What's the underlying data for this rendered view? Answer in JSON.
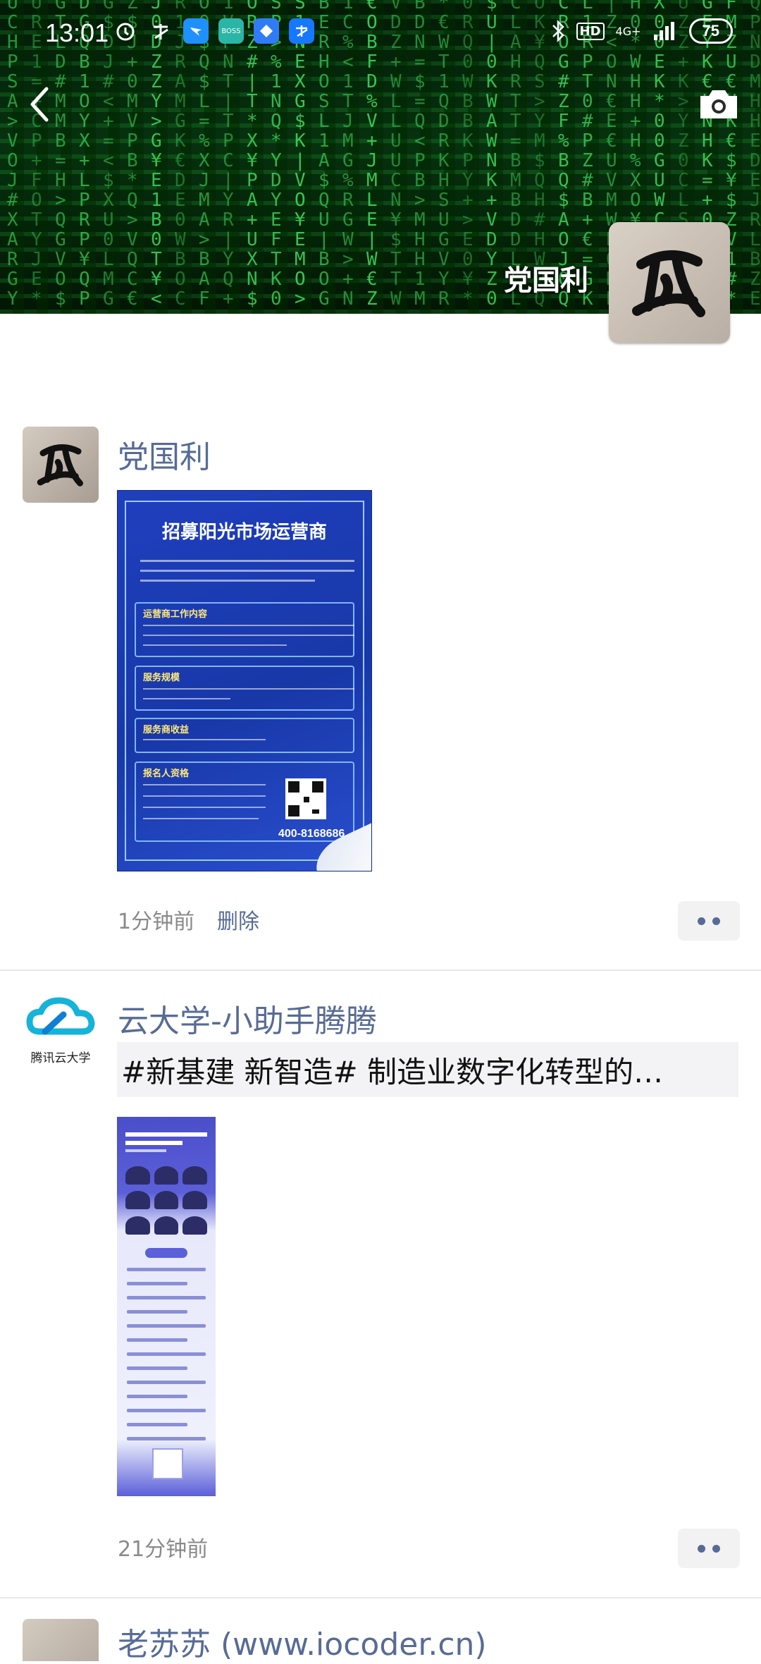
{
  "status_bar": {
    "time": "13:01",
    "right_labels": [
      "HD",
      "4G+"
    ],
    "battery": "75",
    "icons": [
      "alarm-icon",
      "alipay-icon",
      "dingtalk-icon",
      "boss-zhipin-icon",
      "app-icon",
      "alipay-icon",
      "bluetooth-icon",
      "signal-icon"
    ]
  },
  "header": {
    "cover_name": "党国利",
    "back_icon": "back-arrow-icon",
    "camera_icon": "camera-icon"
  },
  "posts": [
    {
      "author": "党国利",
      "image_poster": {
        "title": "招募阳光市场运营商",
        "section_1": "运营商工作内容",
        "section_2": "服务规模",
        "section_3": "服务商收益",
        "section_4": "报名人资格",
        "phone": "400-8168686"
      },
      "time": "1分钟前",
      "delete_label": "删除"
    },
    {
      "author": "云大学-小助手腾腾",
      "avatar_label": "腾讯云大学",
      "share_text": "#新基建 新智造# 制造业数字化转型的…",
      "time": "21分钟前"
    },
    {
      "author": "老苏苏 (www.iocoder.cn)"
    }
  ],
  "colors": {
    "name_link": "#576b95",
    "meta": "#8a8a8a",
    "matrix_green": "#3ed15a"
  }
}
